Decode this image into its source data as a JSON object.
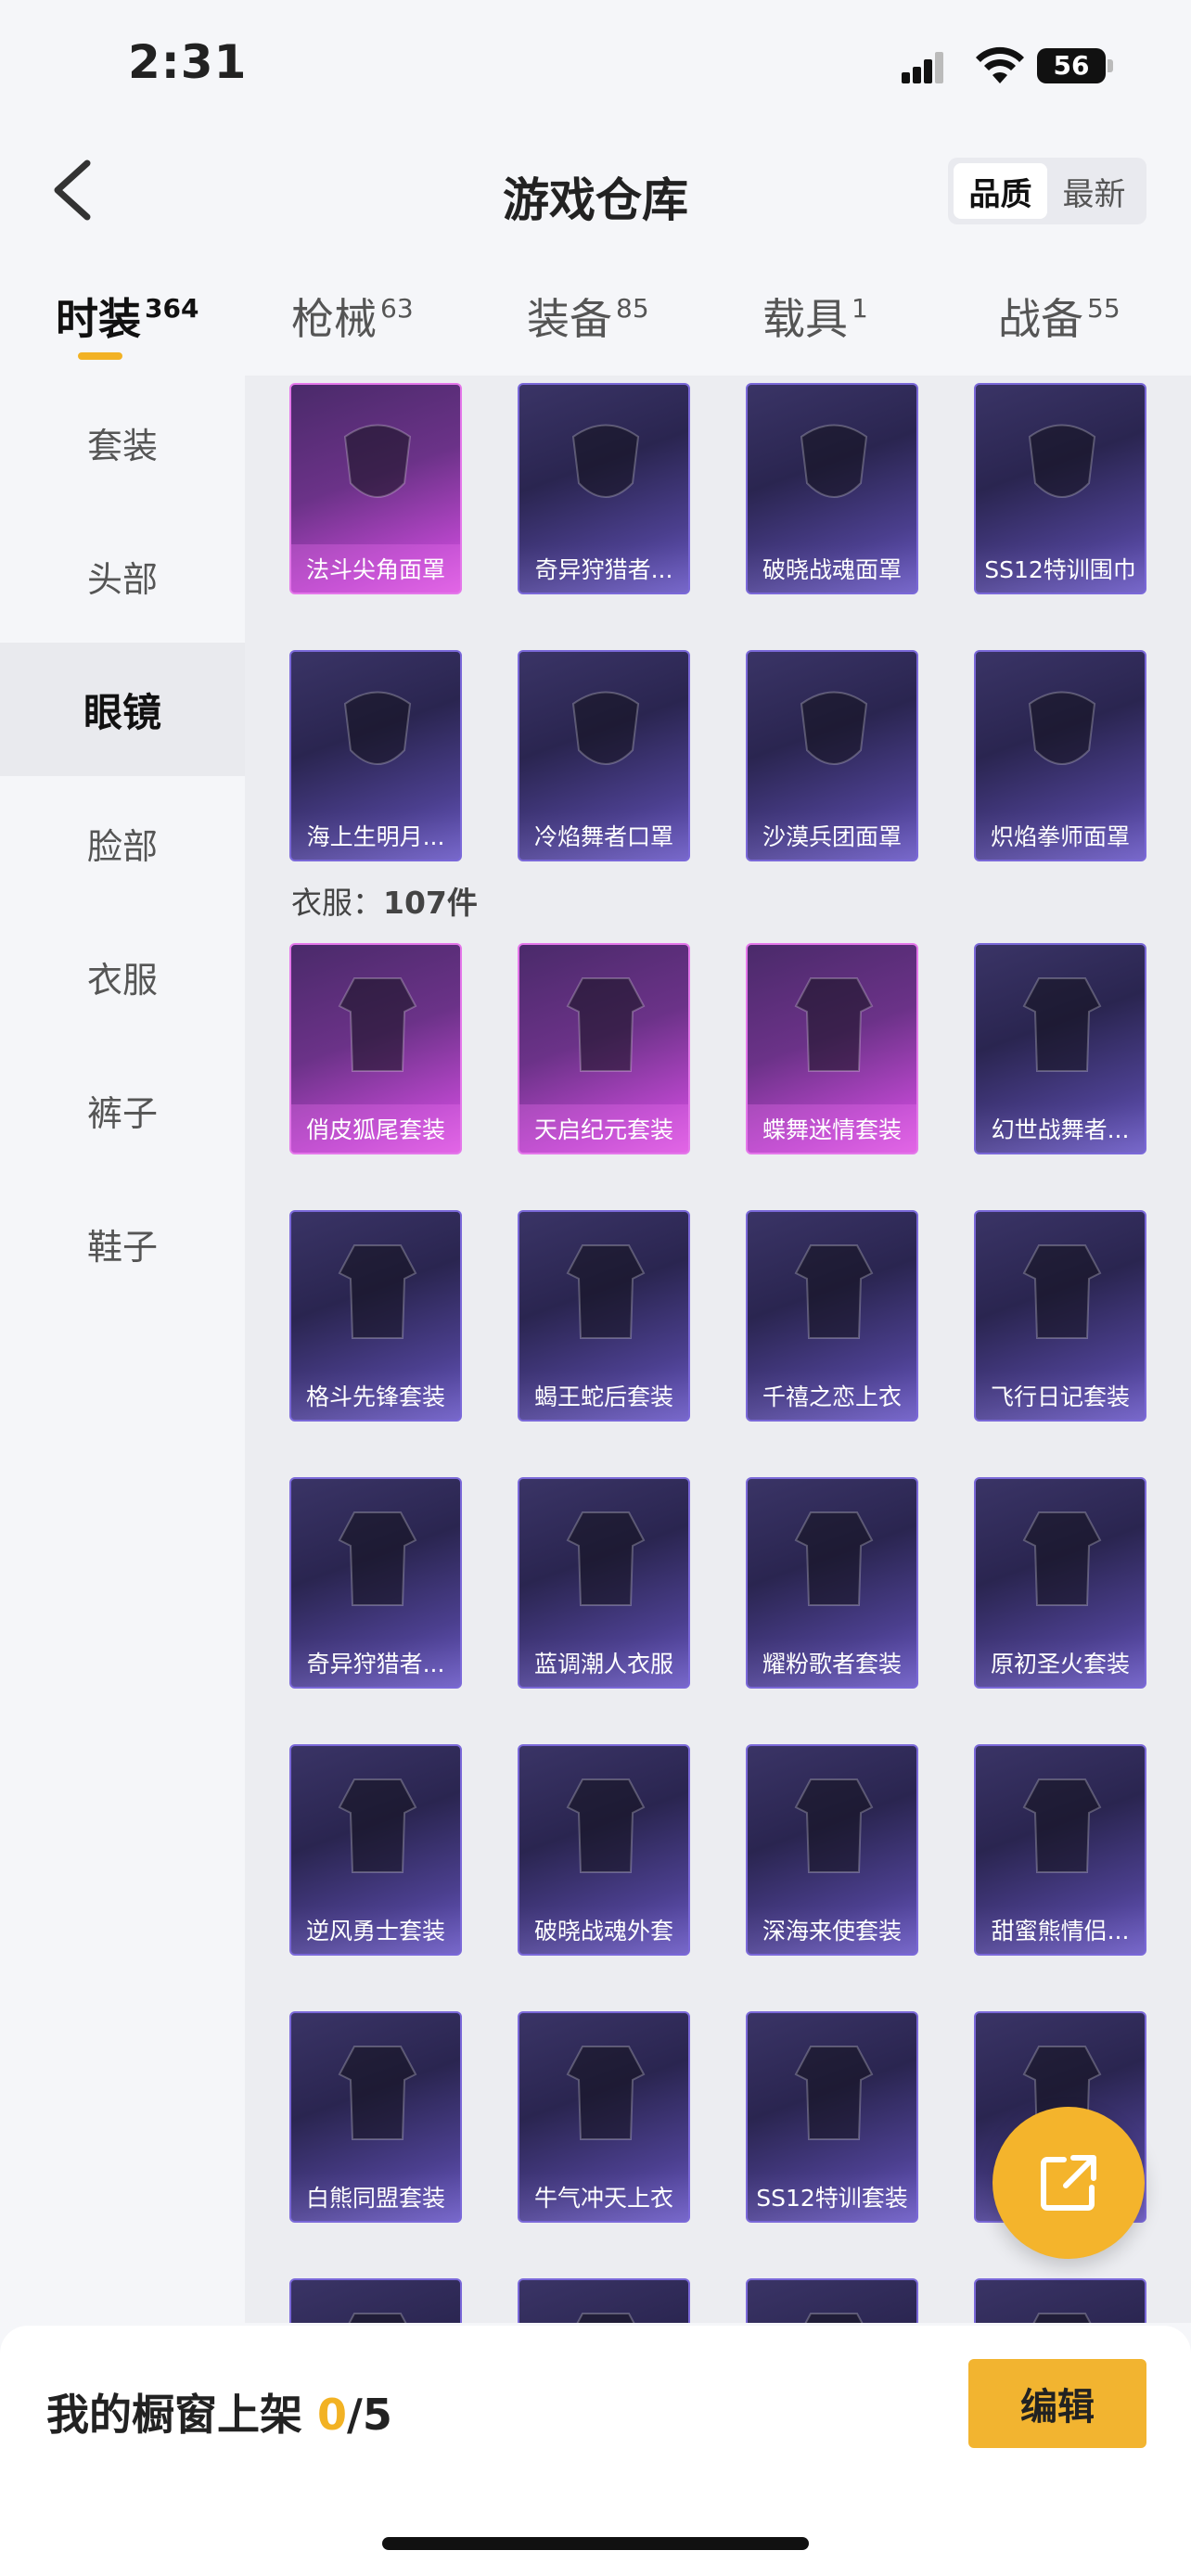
{
  "status_bar": {
    "time": "2:31",
    "battery": "56"
  },
  "nav": {
    "title": "游戏仓库",
    "sort_options": [
      "品质",
      "最新"
    ],
    "sort_active": 0
  },
  "category_tabs": [
    {
      "label": "时装",
      "count": "364",
      "active": true
    },
    {
      "label": "枪械",
      "count": "63",
      "active": false
    },
    {
      "label": "装备",
      "count": "85",
      "active": false
    },
    {
      "label": "载具",
      "count": "1",
      "active": false
    },
    {
      "label": "战备",
      "count": "55",
      "active": false
    }
  ],
  "sidebar": {
    "items": [
      "套装",
      "头部",
      "眼镜",
      "脸部",
      "衣服",
      "裤子",
      "鞋子"
    ],
    "active_index": 2
  },
  "face_items": [
    {
      "name": "法斗尖角面罩",
      "rarity": "pink"
    },
    {
      "name": "奇异狩猎者...",
      "rarity": "purple"
    },
    {
      "name": "破晓战魂面罩",
      "rarity": "purple"
    },
    {
      "name": "SS12特训围巾",
      "rarity": "purple"
    },
    {
      "name": "海上生明月...",
      "rarity": "purple"
    },
    {
      "name": "冷焰舞者口罩",
      "rarity": "purple"
    },
    {
      "name": "沙漠兵团面罩",
      "rarity": "purple"
    },
    {
      "name": "炽焰拳师面罩",
      "rarity": "purple"
    }
  ],
  "clothes_section": {
    "label": "衣服：",
    "count": "107件"
  },
  "clothes_items": [
    {
      "name": "俏皮狐尾套装",
      "rarity": "pink"
    },
    {
      "name": "天启纪元套装",
      "rarity": "pink"
    },
    {
      "name": "蝶舞迷情套装",
      "rarity": "pink"
    },
    {
      "name": "幻世战舞者...",
      "rarity": "purple"
    },
    {
      "name": "格斗先锋套装",
      "rarity": "purple"
    },
    {
      "name": "蝎王蛇后套装",
      "rarity": "purple"
    },
    {
      "name": "千禧之恋上衣",
      "rarity": "purple"
    },
    {
      "name": "飞行日记套装",
      "rarity": "purple"
    },
    {
      "name": "奇异狩猎者...",
      "rarity": "purple"
    },
    {
      "name": "蓝调潮人衣服",
      "rarity": "purple"
    },
    {
      "name": "耀粉歌者套装",
      "rarity": "purple"
    },
    {
      "name": "原初圣火套装",
      "rarity": "purple"
    },
    {
      "name": "逆风勇士套装",
      "rarity": "purple"
    },
    {
      "name": "破晓战魂外套",
      "rarity": "purple"
    },
    {
      "name": "深海来使套装",
      "rarity": "purple"
    },
    {
      "name": "甜蜜熊情侣...",
      "rarity": "purple"
    },
    {
      "name": "白熊同盟套装",
      "rarity": "purple"
    },
    {
      "name": "牛气冲天上衣",
      "rarity": "purple"
    },
    {
      "name": "SS12特训套装",
      "rarity": "purple"
    },
    {
      "name": "",
      "rarity": "purple"
    },
    {
      "name": "",
      "rarity": "purple"
    },
    {
      "name": "",
      "rarity": "purple"
    },
    {
      "name": "",
      "rarity": "purple"
    },
    {
      "name": "",
      "rarity": "purple"
    }
  ],
  "bottom_bar": {
    "label": "我的橱窗上架 ",
    "current": "0",
    "total": "/5",
    "edit_label": "编辑"
  },
  "icons": {
    "back": "chevron-left-icon",
    "share": "share-icon",
    "fab_color": "#f4b42c",
    "accent": "#f2b224"
  }
}
